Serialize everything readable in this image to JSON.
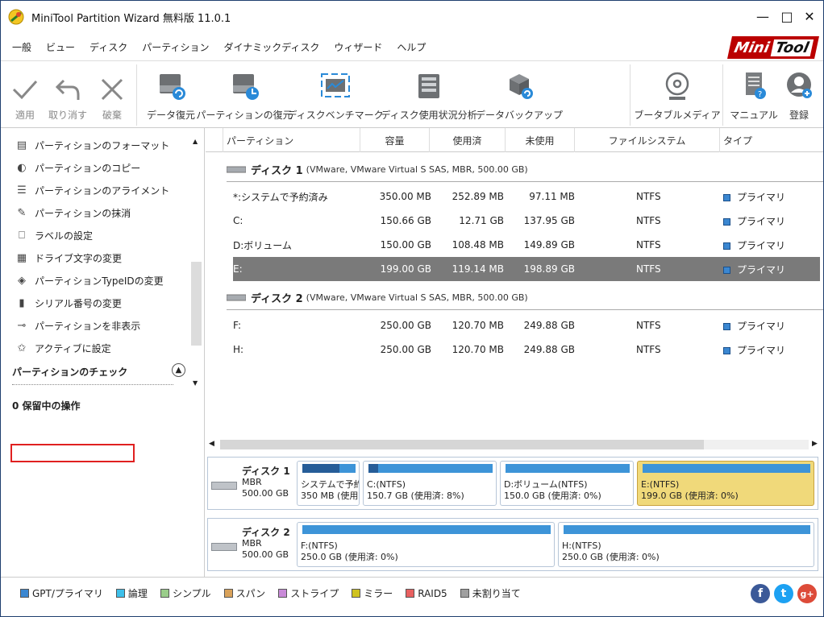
{
  "window": {
    "title": "MiniTool Partition Wizard 無料版 11.0.1"
  },
  "menu": [
    "一般",
    "ビュー",
    "ディスク",
    "パーティション",
    "ダイナミックディスク",
    "ウィザード",
    "ヘルプ"
  ],
  "brand": {
    "mini": "Mini",
    "tool": "Tool"
  },
  "toolbar": {
    "apply": "適用",
    "undo": "取り消す",
    "discard": "破棄",
    "data_recovery": "データ復元",
    "partition_recovery": "パーティションの復元",
    "disk_benchmark": "ディスクベンチマーク",
    "space_analyzer": "ディスク使用状況分析",
    "backup": "データバックアップ",
    "bootable": "ブータブルメディア",
    "manual": "マニュアル",
    "register": "登録"
  },
  "sidebar": {
    "items": [
      "パーティションのフォーマット",
      "パーティションのコピー",
      "パーティションのアライメント",
      "パーティションの抹消",
      "ラベルの設定",
      "ドライブ文字の変更",
      "パーティションTypeIDの変更",
      "シリアル番号の変更",
      "パーティションを非表示",
      "アクティブに設定"
    ],
    "check_section": "パーティションのチェック",
    "pending": "0 保留中の操作"
  },
  "table": {
    "headers": {
      "partition": "パーティション",
      "capacity": "容量",
      "used": "使用済",
      "unused": "未使用",
      "fs": "ファイルシステム",
      "type": "タイプ"
    },
    "disk1": {
      "name": "ディスク 1",
      "desc": "(VMware, VMware Virtual S SAS, MBR, 500.00 GB)"
    },
    "disk2": {
      "name": "ディスク 2",
      "desc": "(VMware, VMware Virtual S SAS, MBR, 500.00 GB)"
    },
    "rows": [
      {
        "p": "*:システムで予約済み",
        "cap": "350.00 MB",
        "used": "252.89 MB",
        "unused": "97.11 MB",
        "fs": "NTFS",
        "type": "プライマリ"
      },
      {
        "p": "C:",
        "cap": "150.66 GB",
        "used": "12.71 GB",
        "unused": "137.95 GB",
        "fs": "NTFS",
        "type": "プライマリ"
      },
      {
        "p": "D:ボリューム",
        "cap": "150.00 GB",
        "used": "108.48 MB",
        "unused": "149.89 GB",
        "fs": "NTFS",
        "type": "プライマリ"
      },
      {
        "p": "E:",
        "cap": "199.00 GB",
        "used": "119.14 MB",
        "unused": "198.89 GB",
        "fs": "NTFS",
        "type": "プライマリ"
      },
      {
        "p": "F:",
        "cap": "250.00 GB",
        "used": "120.70 MB",
        "unused": "249.88 GB",
        "fs": "NTFS",
        "type": "プライマリ"
      },
      {
        "p": "H:",
        "cap": "250.00 GB",
        "used": "120.70 MB",
        "unused": "249.88 GB",
        "fs": "NTFS",
        "type": "プライマリ"
      }
    ]
  },
  "diskmap": {
    "disk1": {
      "name": "ディスク 1",
      "type": "MBR",
      "size": "500.00 GB",
      "parts": [
        {
          "l1": "システムで予約",
          "l2": "350 MB (使用"
        },
        {
          "l1": "C:(NTFS)",
          "l2": "150.7 GB (使用済: 8%)"
        },
        {
          "l1": "D:ボリューム(NTFS)",
          "l2": "150.0 GB (使用済: 0%)"
        },
        {
          "l1": "E:(NTFS)",
          "l2": "199.0 GB (使用済: 0%)"
        }
      ]
    },
    "disk2": {
      "name": "ディスク 2",
      "type": "MBR",
      "size": "500.00 GB",
      "parts": [
        {
          "l1": "F:(NTFS)",
          "l2": "250.0 GB (使用済: 0%)"
        },
        {
          "l1": "H:(NTFS)",
          "l2": "250.0 GB (使用済: 0%)"
        }
      ]
    }
  },
  "legend": [
    {
      "label": "GPT/プライマリ",
      "color": "#3b87d1"
    },
    {
      "label": "論理",
      "color": "#3ec0ea"
    },
    {
      "label": "シンプル",
      "color": "#9acd8a"
    },
    {
      "label": "スパン",
      "color": "#d9a25a"
    },
    {
      "label": "ストライプ",
      "color": "#c98ad8"
    },
    {
      "label": "ミラー",
      "color": "#cfc21f"
    },
    {
      "label": "RAID5",
      "color": "#e86060"
    },
    {
      "label": "未割り当て",
      "color": "#a0a0a0"
    }
  ],
  "social": {
    "facebook": "f",
    "twitter": "t",
    "google": "g+"
  }
}
